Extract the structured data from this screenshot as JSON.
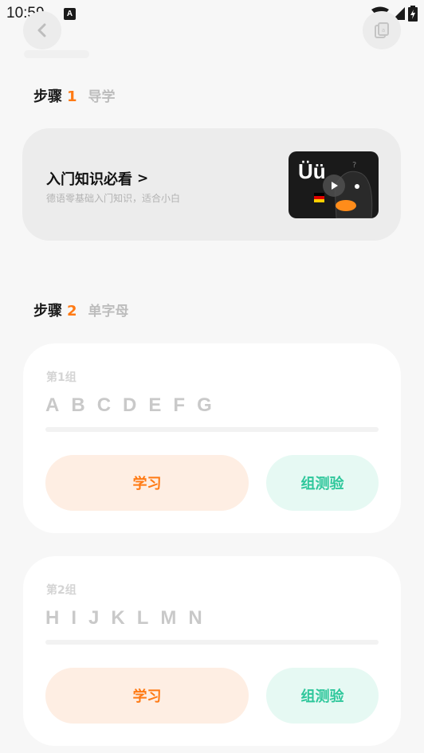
{
  "status_bar": {
    "time": "10:59",
    "notification_glyph": "A"
  },
  "header": {
    "back_icon": "chevron-left-icon",
    "cards_icon": "cards-icon"
  },
  "step1": {
    "label": "步骤",
    "number": "1",
    "subtitle": "导学",
    "card": {
      "title": "入门知识必看",
      "arrow": ">",
      "description": "德语零基础入门知识，适合小白",
      "thumbnail_letters": "Üü"
    }
  },
  "step2": {
    "label": "步骤",
    "number": "2",
    "subtitle": "单字母",
    "groups": [
      {
        "label": "第1组",
        "letters": [
          "A",
          "B",
          "C",
          "D",
          "E",
          "F",
          "G"
        ],
        "progress": 0,
        "learn_label": "学习",
        "test_label": "组测验"
      },
      {
        "label": "第2组",
        "letters": [
          "H",
          "I",
          "J",
          "K",
          "L",
          "M",
          "N"
        ],
        "progress": 0,
        "learn_label": "学习",
        "test_label": "组测验"
      }
    ]
  },
  "colors": {
    "accent": "#ff7a14",
    "test_green": "#2ec79b",
    "learn_bg": "#feeee3",
    "test_bg": "#e6f9f3"
  }
}
